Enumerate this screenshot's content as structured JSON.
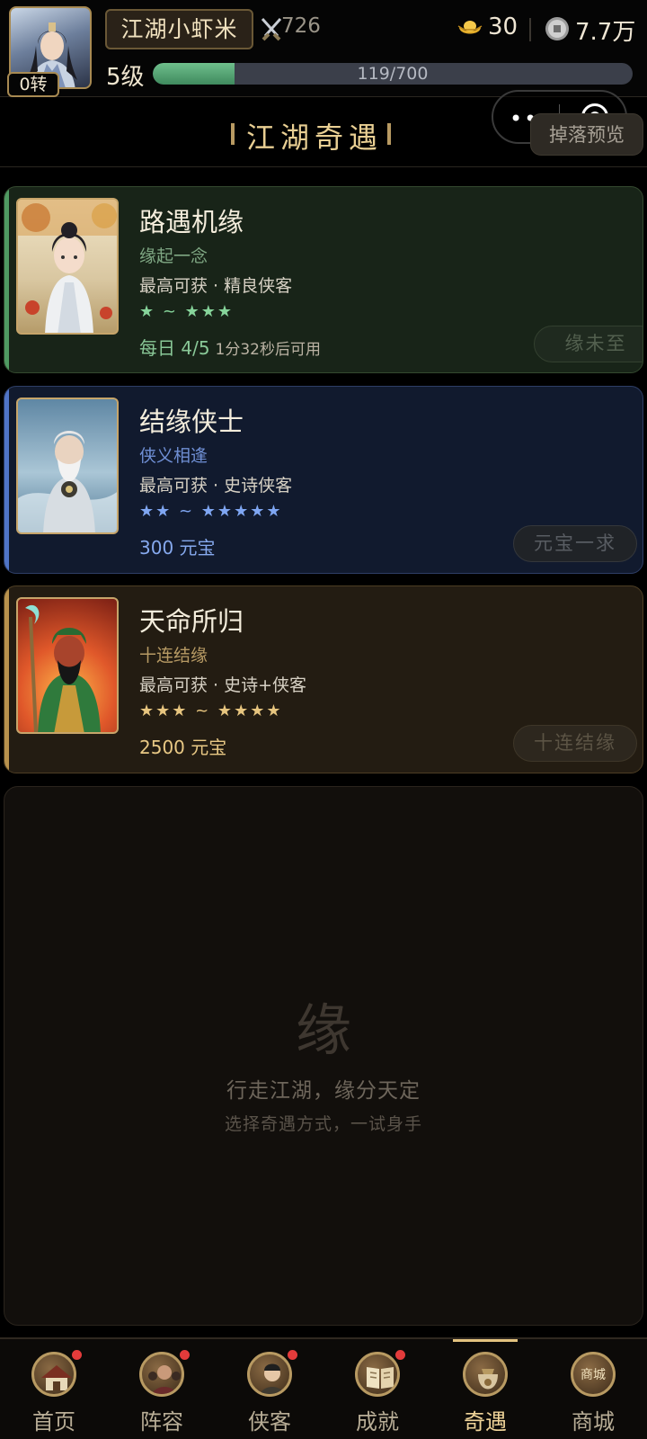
{
  "header": {
    "rebirth": "0转",
    "player_name": "江湖小虾米",
    "power": "726",
    "ingot": "30",
    "coins": "7.7万",
    "level": "5级",
    "exp_text": "119/700",
    "exp_progress": 0.17
  },
  "title": "江湖奇遇",
  "drop_preview": "掉落预览",
  "capsule": {
    "dots": "•••"
  },
  "cards": [
    {
      "title": "路遇机缘",
      "subtitle": "缘起一念",
      "reward": "最高可获 · 精良侠客",
      "stars": "★ ~ ★★★",
      "cost": "每日 4/5",
      "cooldown": "1分32秒后可用",
      "button": "缘未至",
      "accent": "#4f9a62"
    },
    {
      "title": "结缘侠士",
      "subtitle": "侠义相逢",
      "reward": "最高可获 · 史诗侠客",
      "stars": "★★ ~ ★★★★★",
      "cost": "300 元宝",
      "button": "元宝一求",
      "accent": "#4f74c7"
    },
    {
      "title": "天命所归",
      "subtitle": "十连结缘",
      "reward": "最高可获 · 史诗+侠客",
      "stars": "★★★ ~ ★★★★",
      "cost": "2500 元宝",
      "button": "十连结缘",
      "accent": "#b8924d"
    }
  ],
  "empty_panel": {
    "glyph": "缘",
    "line1": "行走江湖，缘分天定",
    "line2": "选择奇遇方式，一试身手"
  },
  "nav": {
    "items": [
      {
        "label": "首页",
        "icon": "home-icon",
        "badge": true
      },
      {
        "label": "阵容",
        "icon": "lineup-icon",
        "badge": true
      },
      {
        "label": "侠客",
        "icon": "hero-icon",
        "badge": true
      },
      {
        "label": "成就",
        "icon": "book-icon",
        "badge": true
      },
      {
        "label": "奇遇",
        "icon": "bag-icon",
        "badge": false,
        "active": true
      },
      {
        "label": "商城",
        "icon": "shop-icon",
        "badge": false
      }
    ],
    "shop_icon_text": "商城"
  }
}
